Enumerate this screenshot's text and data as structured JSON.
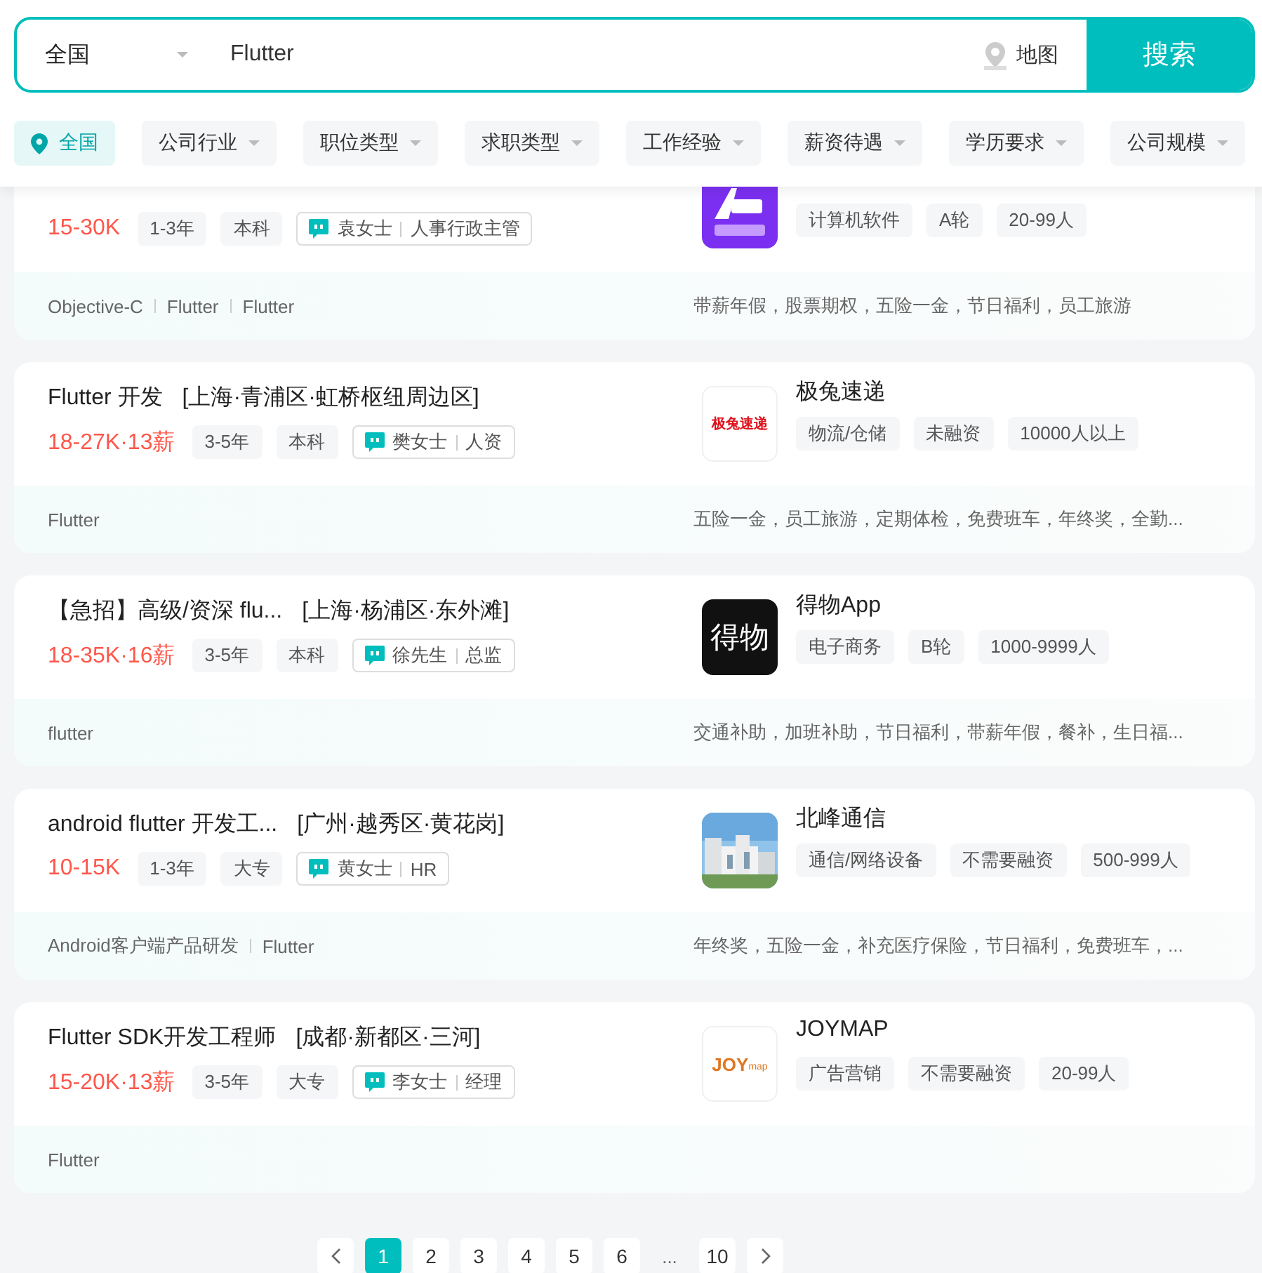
{
  "search": {
    "city": "全国",
    "query": "Flutter",
    "map_label": "地图",
    "button": "搜索"
  },
  "filters": [
    {
      "label": "全国",
      "selected": true
    },
    {
      "label": "公司行业",
      "selected": false
    },
    {
      "label": "职位类型",
      "selected": false
    },
    {
      "label": "求职类型",
      "selected": false
    },
    {
      "label": "工作经验",
      "selected": false
    },
    {
      "label": "薪资待遇",
      "selected": false
    },
    {
      "label": "学历要求",
      "selected": false
    },
    {
      "label": "公司规模",
      "selected": false
    }
  ],
  "jobs": [
    {
      "salary": "15-30K",
      "tags": [
        "1-3年",
        "本科"
      ],
      "recruiter": "袁女士",
      "recruiter_role": "人事行政主管",
      "company_tags": [
        "计算机软件",
        "A轮",
        "20-99人"
      ],
      "logo": {
        "kind": "purple"
      },
      "skills": [
        "Objective-C",
        "Flutter",
        "Flutter"
      ],
      "benefits": "带薪年假，股票期权，五险一金，节日福利，员工旅游"
    },
    {
      "title": "Flutter 开发",
      "location": "[上海·青浦区·虹桥枢纽周边区]",
      "salary": "18-27K·13薪",
      "tags": [
        "3-5年",
        "本科"
      ],
      "recruiter": "樊女士",
      "recruiter_role": "人资",
      "company": "极兔速递",
      "company_tags": [
        "物流/仓储",
        "未融资",
        "10000人以上"
      ],
      "logo": {
        "kind": "redtext",
        "text": "极兔速递"
      },
      "skills": [
        "Flutter"
      ],
      "benefits": "五险一金，员工旅游，定期体检，免费班车，年终奖，全勤..."
    },
    {
      "title": "【急招】高级/资深 flu...",
      "location": "[上海·杨浦区·东外滩]",
      "salary": "18-35K·16薪",
      "tags": [
        "3-5年",
        "本科"
      ],
      "recruiter": "徐先生",
      "recruiter_role": "总监",
      "company": "得物App",
      "company_tags": [
        "电子商务",
        "B轮",
        "1000-9999人"
      ],
      "logo": {
        "kind": "dark",
        "text": "得物"
      },
      "skills": [
        "flutter"
      ],
      "benefits": "交通补助，加班补助，节日福利，带薪年假，餐补，生日福..."
    },
    {
      "title": "android flutter 开发工...",
      "location": "[广州·越秀区·黄花岗]",
      "salary": "10-15K",
      "tags": [
        "1-3年",
        "大专"
      ],
      "recruiter": "黄女士",
      "recruiter_role": "HR",
      "company": "北峰通信",
      "company_tags": [
        "通信/网络设备",
        "不需要融资",
        "500-999人"
      ],
      "logo": {
        "kind": "picture"
      },
      "skills": [
        "Android客户端产品研发",
        "Flutter"
      ],
      "benefits": "年终奖，五险一金，补充医疗保险，节日福利，免费班车，..."
    },
    {
      "title": "Flutter SDK开发工程师",
      "location": "[成都·新都区·三河]",
      "salary": "15-20K·13薪",
      "tags": [
        "3-5年",
        "大专"
      ],
      "recruiter": "李女士",
      "recruiter_role": "经理",
      "company": "JOYMAP",
      "company_tags": [
        "广告营销",
        "不需要融资",
        "20-99人"
      ],
      "logo": {
        "kind": "joy",
        "text": "JOY",
        "subtext": "map"
      },
      "skills": [
        "Flutter"
      ]
    }
  ],
  "pagination": [
    {
      "label": "1",
      "selected": true
    },
    {
      "label": "2",
      "selected": false
    },
    {
      "label": "3",
      "selected": false
    },
    {
      "label": "4",
      "selected": false
    },
    {
      "label": "5",
      "selected": false
    },
    {
      "label": "6",
      "selected": false
    },
    {
      "label": "...",
      "kind": "ellipsis"
    },
    {
      "label": "10",
      "selected": false
    }
  ]
}
